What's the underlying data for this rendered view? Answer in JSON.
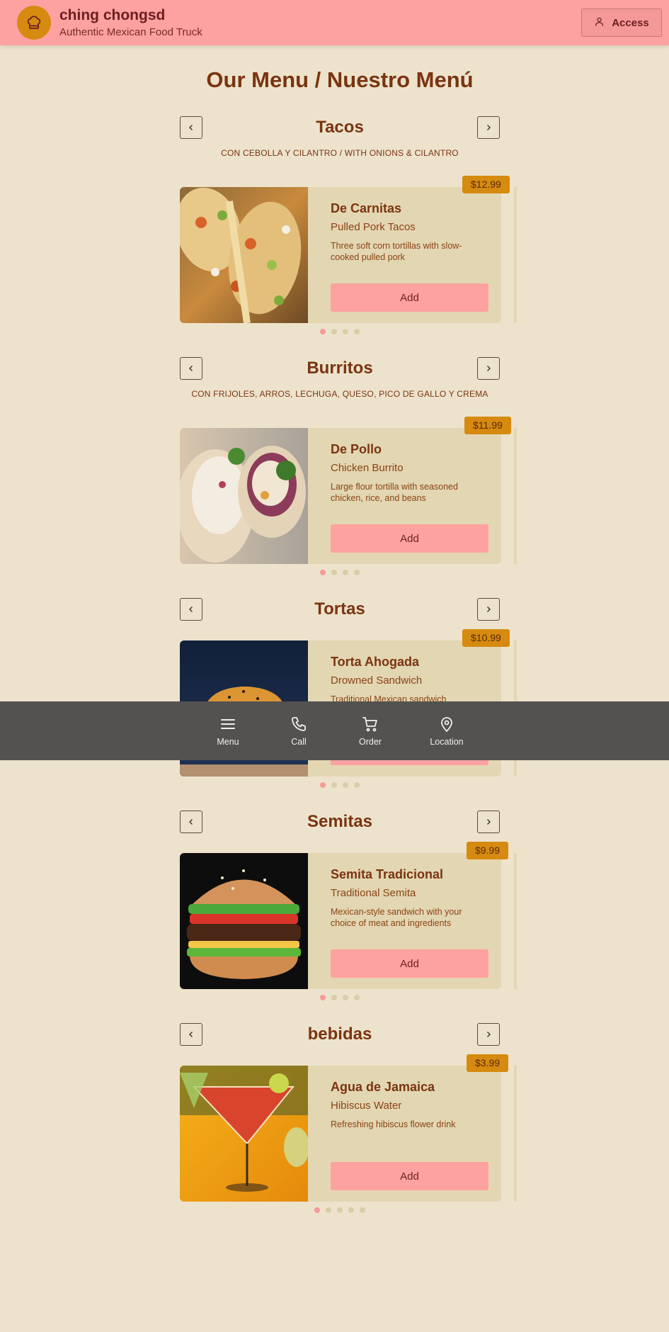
{
  "header": {
    "brand_name": "ching chongsd",
    "brand_sub": "Authentic Mexican Food Truck",
    "access_label": "Access"
  },
  "page_title": "Our Menu / Nuestro Menú",
  "categories": [
    {
      "title": "Tacos",
      "subtitle": "CON CEBOLLA Y CILANTRO / WITH ONIONS & CILANTRO",
      "item": {
        "name": "De Carnitas",
        "english": "Pulled Pork Tacos",
        "description": "Three soft corn tortillas with slow-cooked pulled pork",
        "price": "$12.99",
        "add_label": "Add"
      },
      "dots": 4
    },
    {
      "title": "Burritos",
      "subtitle": "CON FRIJOLES, ARROS, LECHUGA, QUESO, PICO DE GALLO Y CREMA",
      "item": {
        "name": "De Pollo",
        "english": "Chicken Burrito",
        "description": "Large flour tortilla with seasoned chicken, rice, and beans",
        "price": "$11.99",
        "add_label": "Add"
      },
      "dots": 4
    },
    {
      "title": "Tortas",
      "subtitle": "",
      "item": {
        "name": "Torta Ahogada",
        "english": "Drowned Sandwich",
        "description": "Traditional Mexican sandwich drowned",
        "price": "$10.99",
        "add_label": "Add"
      },
      "dots": 4
    },
    {
      "title": "Semitas",
      "subtitle": "",
      "item": {
        "name": "Semita Tradicional",
        "english": "Traditional Semita",
        "description": "Mexican-style sandwich with your choice of meat and ingredients",
        "price": "$9.99",
        "add_label": "Add"
      },
      "dots": 4
    },
    {
      "title": "bebidas",
      "subtitle": "",
      "item": {
        "name": "Agua de Jamaica",
        "english": "Hibiscus Water",
        "description": "Refreshing hibiscus flower drink",
        "price": "$3.99",
        "add_label": "Add"
      },
      "dots": 5
    }
  ],
  "bottom_nav": {
    "menu": "Menu",
    "call": "Call",
    "order": "Order",
    "location": "Location"
  },
  "colors": {
    "background": "#ede3cc",
    "header": "#fea1a1",
    "accent": "#d68a10",
    "text": "#7a3410",
    "card": "#e3d6b2",
    "bottom_nav": "#535250"
  }
}
